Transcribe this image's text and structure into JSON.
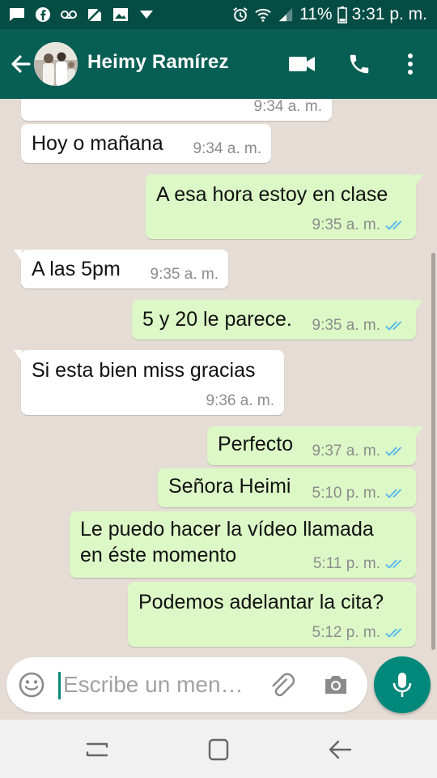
{
  "status_bar": {
    "battery": "11%",
    "time": "3:31 p. m.",
    "icons": [
      "chat-icon",
      "facebook-icon",
      "voicemail-icon",
      "no-sim-icon",
      "image-icon",
      "download-icon",
      "alarm-icon",
      "wifi-icon",
      "signal-icon",
      "battery-icon"
    ]
  },
  "header": {
    "contact_name": "Heimy Ramírez",
    "icons": [
      "back-arrow-icon",
      "video-call-icon",
      "phone-icon",
      "more-vertical-icon"
    ]
  },
  "messages": [
    {
      "direction": "in",
      "text": "",
      "time": "9:34 a. m."
    },
    {
      "direction": "in",
      "text": "Hoy o mañana",
      "time": "9:34 a. m."
    },
    {
      "direction": "out",
      "text": "A esa hora estoy en clase",
      "time": "9:35 a. m.",
      "read": true
    },
    {
      "direction": "in",
      "text": "A las 5pm",
      "time": "9:35 a. m."
    },
    {
      "direction": "out",
      "text": "5 y 20 le parece.",
      "time": "9:35 a. m.",
      "read": true
    },
    {
      "direction": "in",
      "text": "Si esta bien miss gracias",
      "time": "9:36 a. m."
    },
    {
      "direction": "out",
      "text": "Perfecto",
      "time": "9:37 a. m.",
      "read": true
    },
    {
      "direction": "out",
      "text": "Señora Heimi",
      "time": "5:10 p. m.",
      "read": true
    },
    {
      "direction": "out",
      "lines": [
        "Le puedo hacer la vídeo llamada",
        "en éste momento"
      ],
      "time": "5:11 p. m.",
      "read": true
    },
    {
      "direction": "out",
      "text": "Podemos adelantar la cita?",
      "time": "5:12 p. m.",
      "read": true
    }
  ],
  "composer": {
    "placeholder": "Escribe un men…",
    "value": "",
    "icons": [
      "emoji-icon",
      "attach-icon",
      "camera-icon",
      "mic-icon"
    ]
  },
  "nav_bar": {
    "icons": [
      "recents-icon",
      "home-icon",
      "back-icon"
    ]
  },
  "colors": {
    "status_bar": "#054d44",
    "header": "#075e54",
    "chat_background": "#e5ddd5",
    "incoming_bubble": "#ffffff",
    "outgoing_bubble": "#dcf8c6",
    "read_ticks": "#4fb6ec",
    "mic_button": "#00897b"
  }
}
